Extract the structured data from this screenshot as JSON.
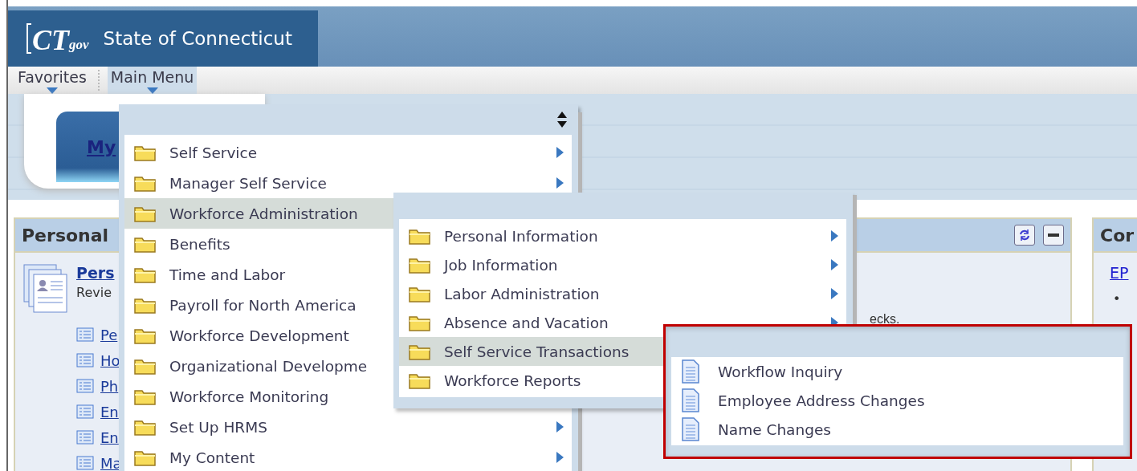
{
  "header": {
    "logo": {
      "mark": "CT",
      "suffix": "gov"
    },
    "title": "State of Connecticut"
  },
  "nav": [
    {
      "label": "Favorites",
      "selected": false
    },
    {
      "label": "Main Menu",
      "selected": true
    }
  ],
  "tab": {
    "label": "My"
  },
  "left_panel": {
    "title": "Personal",
    "link": "Pers",
    "description": "Revie",
    "links": [
      "Pe",
      "Ho",
      "Ph",
      "En",
      "En",
      "Ma"
    ]
  },
  "middle_panel": {
    "text": "ecks."
  },
  "right_panel": {
    "title": "Cor",
    "link": "EP",
    "bullet": "•"
  },
  "main_menu": {
    "items": [
      {
        "label": "Self Service",
        "arrow": true,
        "selected": false
      },
      {
        "label": "Manager Self Service",
        "arrow": true,
        "selected": false
      },
      {
        "label": "Workforce Administration",
        "arrow": false,
        "selected": true
      },
      {
        "label": "Benefits",
        "arrow": false,
        "selected": false
      },
      {
        "label": "Time and Labor",
        "arrow": false,
        "selected": false
      },
      {
        "label": "Payroll for North America",
        "arrow": false,
        "selected": false
      },
      {
        "label": "Workforce Development",
        "arrow": false,
        "selected": false
      },
      {
        "label": "Organizational Developme",
        "arrow": false,
        "selected": false
      },
      {
        "label": "Workforce Monitoring",
        "arrow": false,
        "selected": false
      },
      {
        "label": "Set Up HRMS",
        "arrow": true,
        "selected": false
      },
      {
        "label": "My Content",
        "arrow": true,
        "selected": false
      }
    ]
  },
  "submenu": {
    "items": [
      {
        "label": "Personal Information",
        "arrow": true,
        "selected": false
      },
      {
        "label": "Job Information",
        "arrow": true,
        "selected": false
      },
      {
        "label": "Labor Administration",
        "arrow": true,
        "selected": false
      },
      {
        "label": "Absence and Vacation",
        "arrow": true,
        "selected": false
      },
      {
        "label": "Self Service Transactions",
        "arrow": false,
        "selected": true
      },
      {
        "label": "Workforce Reports",
        "arrow": false,
        "selected": false
      }
    ]
  },
  "sub_submenu": {
    "highlighted": true,
    "items": [
      {
        "label": "Workflow Inquiry",
        "kind": "page"
      },
      {
        "label": "Employee Address Changes",
        "kind": "page"
      },
      {
        "label": "Name Changes",
        "kind": "page"
      }
    ]
  }
}
